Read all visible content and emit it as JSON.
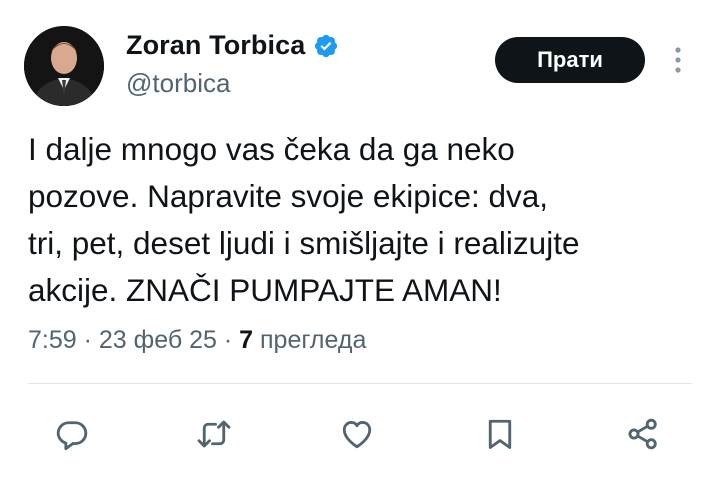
{
  "author": {
    "display_name": "Zoran Torbica",
    "handle": "@torbica",
    "verified": true,
    "verified_color": "#1d9bf0"
  },
  "follow_button": {
    "label": "Прати"
  },
  "tweet": {
    "text": "I dalje mnogo vas čeka da ga neko\npozove. Napravite svoje ekipice: dva,\ntri, pet, deset ljudi i smišljajte i realizujte\nakcije. ZNAČI PUMPAJTE AMAN!",
    "time": "7:59",
    "separator": " · ",
    "date": "23 феб 25",
    "views_count": "7",
    "views_label": "прегледа"
  },
  "actions": {
    "icons": [
      "reply-icon",
      "retweet-icon",
      "like-icon",
      "bookmark-icon",
      "share-icon"
    ]
  },
  "colors": {
    "text": "#0f1419",
    "muted": "#536471",
    "button_bg": "#0f1419",
    "divider": "#e1e6ea"
  }
}
